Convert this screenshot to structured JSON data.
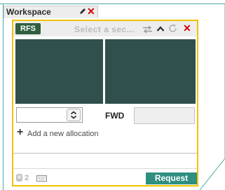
{
  "workspace": {
    "title": "Workspace",
    "icons": {
      "edit": "pencil-icon",
      "close": "close-icon"
    }
  },
  "widget": {
    "badge": "RFS",
    "currency_placeholder": "Select a sec...",
    "header_icons": [
      "swap-icon",
      "caret-up-icon",
      "refresh-icon",
      "close-icon"
    ],
    "amount": {
      "value": "",
      "placeholder": ""
    },
    "fwd_label": "FWD",
    "fwd_value": "",
    "add_allocation_label": "Add a new allocation",
    "footer": {
      "participants_count": "2",
      "request_label": "Request"
    }
  },
  "colors": {
    "frame_teal": "#4aa9a0",
    "widget_border": "#f2c200",
    "badge_bg": "#2f5f3f",
    "tile_bg": "#2f504d",
    "close_red": "#d60000",
    "request_bg": "#2f8f80"
  }
}
